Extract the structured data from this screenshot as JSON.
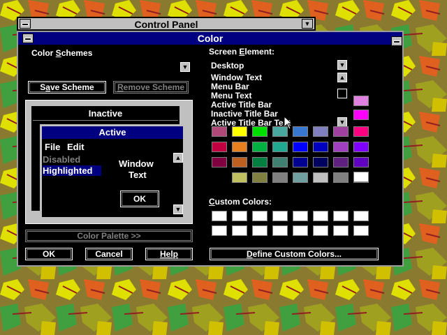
{
  "control_panel": {
    "title": "Control Panel"
  },
  "dialog": {
    "title": "Color",
    "color_schemes_label_pre": "Color ",
    "color_schemes_label_u": "S",
    "color_schemes_label_post": "chemes",
    "save_scheme_pre": "S",
    "save_scheme_u": "a",
    "save_scheme_post": "ve Scheme",
    "remove_scheme_pre": "",
    "remove_scheme_u": "R",
    "remove_scheme_post": "emove Scheme",
    "color_palette_label": "Color Palette >>",
    "ok_label": "OK",
    "cancel_label": "Cancel",
    "help_label": "Help",
    "screen_element_pre": "Screen ",
    "screen_element_u": "E",
    "screen_element_post": "lement:",
    "screen_element_value": "Desktop",
    "screen_element_items": [
      "Window Text",
      "Menu Bar",
      "Menu Text",
      "Active Title Bar",
      "Inactive Title Bar",
      "Active Title Bar Text"
    ],
    "custom_colors_pre": "",
    "custom_colors_u": "C",
    "custom_colors_post": "ustom Colors:",
    "define_custom_pre": "",
    "define_custom_u": "D",
    "define_custom_post": "efine Custom Colors..."
  },
  "preview": {
    "inactive_title": "Inactive",
    "active_title": "Active",
    "menu_file": "File",
    "menu_edit": "Edit",
    "disabled": "Disabled",
    "highlighted": "Highlighted",
    "window_text_1": "Window",
    "window_text_2": "Text",
    "ok": "OK"
  },
  "basic_colors": [
    "#b04878",
    "#ffff00",
    "#00e000",
    "#48a8a0",
    "#3878d0",
    "#8080c0",
    "#a040a0",
    "#ff0080",
    "#c00040",
    "#e88020",
    "#00b040",
    "#20a890",
    "#0000ff",
    "#0000c0",
    "#a040c0",
    "#8000ff",
    "#800040",
    "#c06020",
    "#008040",
    "#408070",
    "#000090",
    "#000060",
    "#602080",
    "#6000c0",
    "#402020",
    "#c0c060",
    "#808040",
    "#808080",
    "#70a0a0",
    "#c0c0c0",
    "#808080",
    "#ffffff"
  ],
  "side_colors": [
    "#e080e0",
    "#ff00ff",
    "#ffffff"
  ]
}
